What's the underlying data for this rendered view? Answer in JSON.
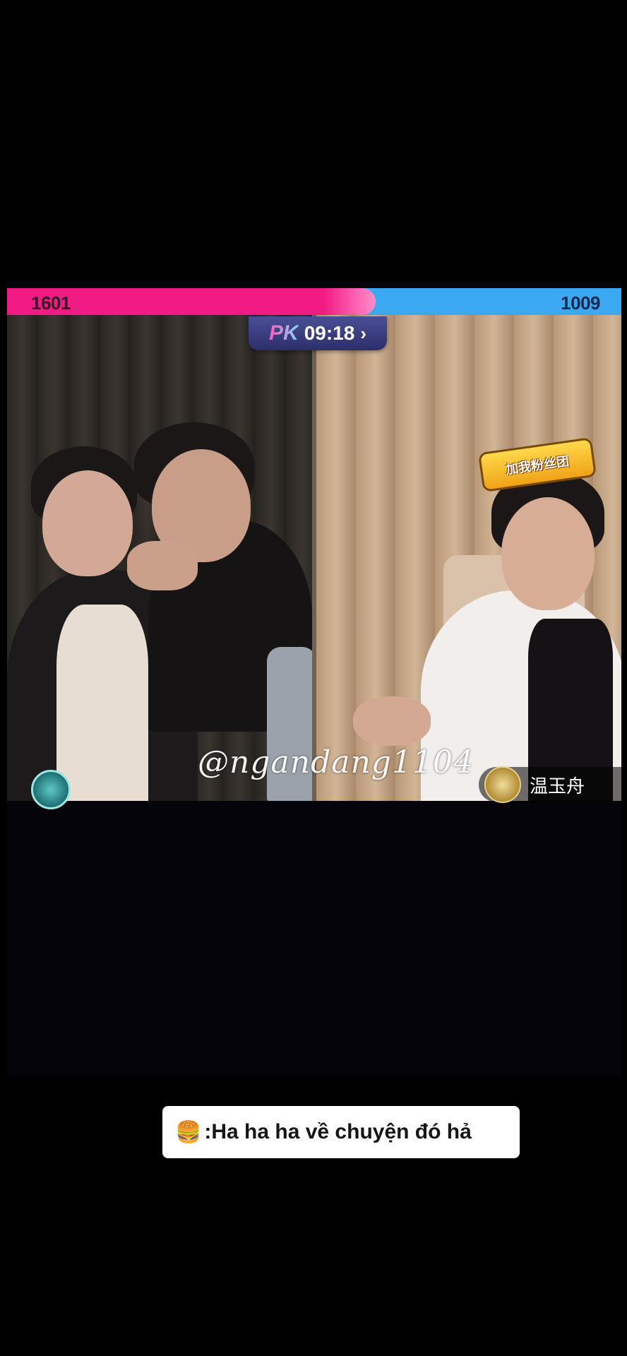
{
  "pk": {
    "left_score": "1601",
    "right_score": "1009",
    "left_fraction": 0.6,
    "logo": "PK",
    "timer": "09:18",
    "arrow": "›",
    "left_color": "#f21b84",
    "right_color": "#3aa9f1"
  },
  "streams": {
    "right_sticker": "加我粉丝团",
    "right_name": "温玉舟"
  },
  "watermark": "@ngandang1104",
  "caption": {
    "emoji": "🍔",
    "text": ":Ha ha ha về chuyện đó hả"
  },
  "icons": [
    "burger-icon",
    "chevron-right-icon",
    "fan-badge-icon",
    "level-badge-icon"
  ]
}
